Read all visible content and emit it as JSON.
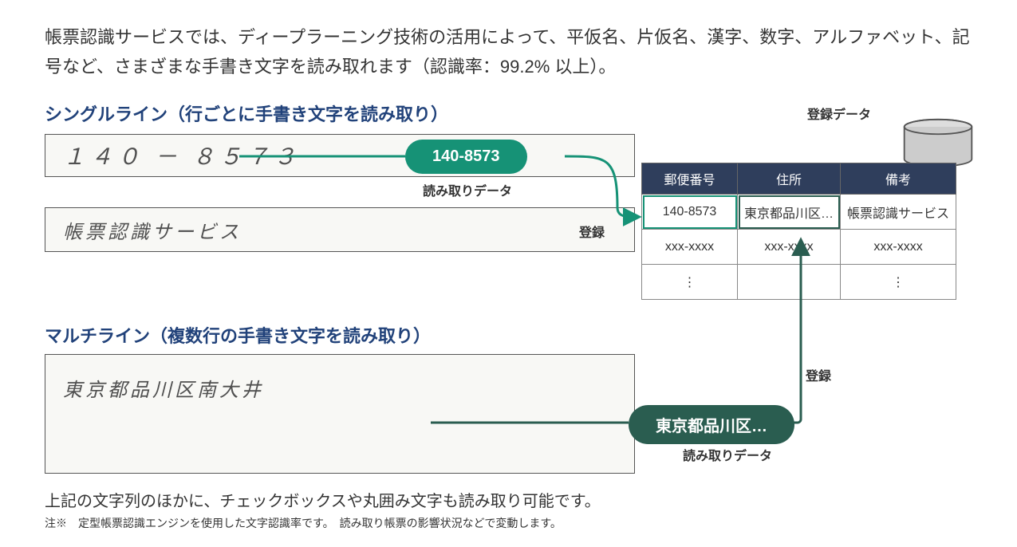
{
  "intro": "帳票認識サービスでは、ディープラーニング技術の活用によって、平仮名、片仮名、漢字、数字、アルファベット、記号など、さまざまな手書き文字を読み取れます（認識率：99.2% 以上）。",
  "sections": {
    "single": {
      "title": "シングルライン（行ごとに手書き文字を読み取り）",
      "input1": "１４０ － ８５７３",
      "input2": "帳票認識サービス",
      "pill": "140-8573",
      "pill_label": "読み取りデータ",
      "register_label": "登録"
    },
    "multi": {
      "title": "マルチライン（複数行の手書き文字を読み取り）",
      "input": "東京都品川区南大井",
      "pill": "東京都品川区…",
      "pill_label": "読み取りデータ",
      "register_label": "登録"
    }
  },
  "table": {
    "label": "登録データ",
    "headers": [
      "郵便番号",
      "住所",
      "備考"
    ],
    "rows": [
      [
        "140-8573",
        "東京都品川区…",
        "帳票認識サービス"
      ],
      [
        "xxx-xxxx",
        "xxx-xxxx",
        "xxx-xxxx"
      ],
      [
        "⋮",
        "",
        "⋮"
      ]
    ]
  },
  "bottom": "上記の文字列のほかに、チェックボックスや丸囲み文字も読み取り可能です。",
  "note": "注※　定型帳票認識エンジンを使用した文字認識率です。　読み取り帳票の影響状況などで変動します。"
}
